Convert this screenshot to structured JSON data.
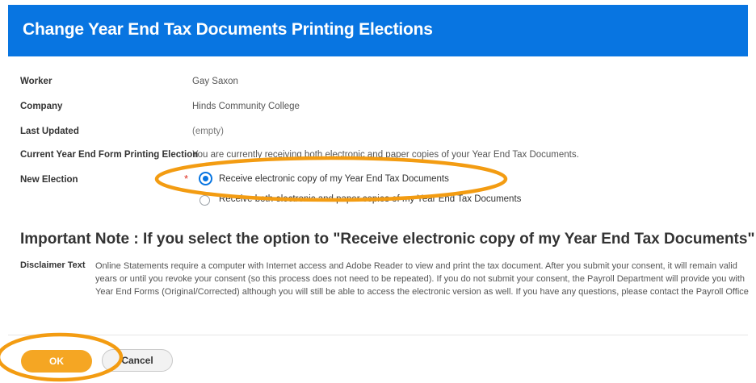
{
  "page": {
    "title": "Change Year End Tax Documents Printing Elections"
  },
  "fields": [
    {
      "label": "Worker",
      "value": "Gay Saxon"
    },
    {
      "label": "Company",
      "value": "Hinds Community College"
    },
    {
      "label": "Last Updated",
      "value": "(empty)"
    },
    {
      "label": "Current Year End Form Printing Election",
      "value": "You are currently receiving both electronic and paper copies of your Year End Tax Documents."
    }
  ],
  "election": {
    "label": "New Election",
    "required_mark": "*",
    "options": [
      {
        "label": "Receive electronic copy of my Year End Tax Documents",
        "selected": true
      },
      {
        "label": "Receive both electronic and paper copies of my Year End Tax Documents",
        "selected": false
      }
    ]
  },
  "note": {
    "heading": "Important Note : If you select the option to \"Receive electronic copy of my Year End Tax Documents\" :",
    "disclaimer_label": "Disclaimer Text",
    "disclaimer_lines": [
      "Online Statements require a computer with Internet access and Adobe Reader to view and print the tax document. After you submit your consent, it will remain valid",
      "years or until you revoke your consent (so this process does not need to be repeated). If you do not submit your consent, the Payroll Department will provide you with",
      "Year End Forms (Original/Corrected) although you will still be able to access the electronic version as well. If you have any questions, please contact the Payroll Office"
    ]
  },
  "buttons": {
    "ok": "OK",
    "cancel": "Cancel"
  },
  "colors": {
    "header": "#0875e1",
    "primary_button": "#f5a623",
    "annotation": "#f39c12",
    "required": "#de2e21"
  }
}
